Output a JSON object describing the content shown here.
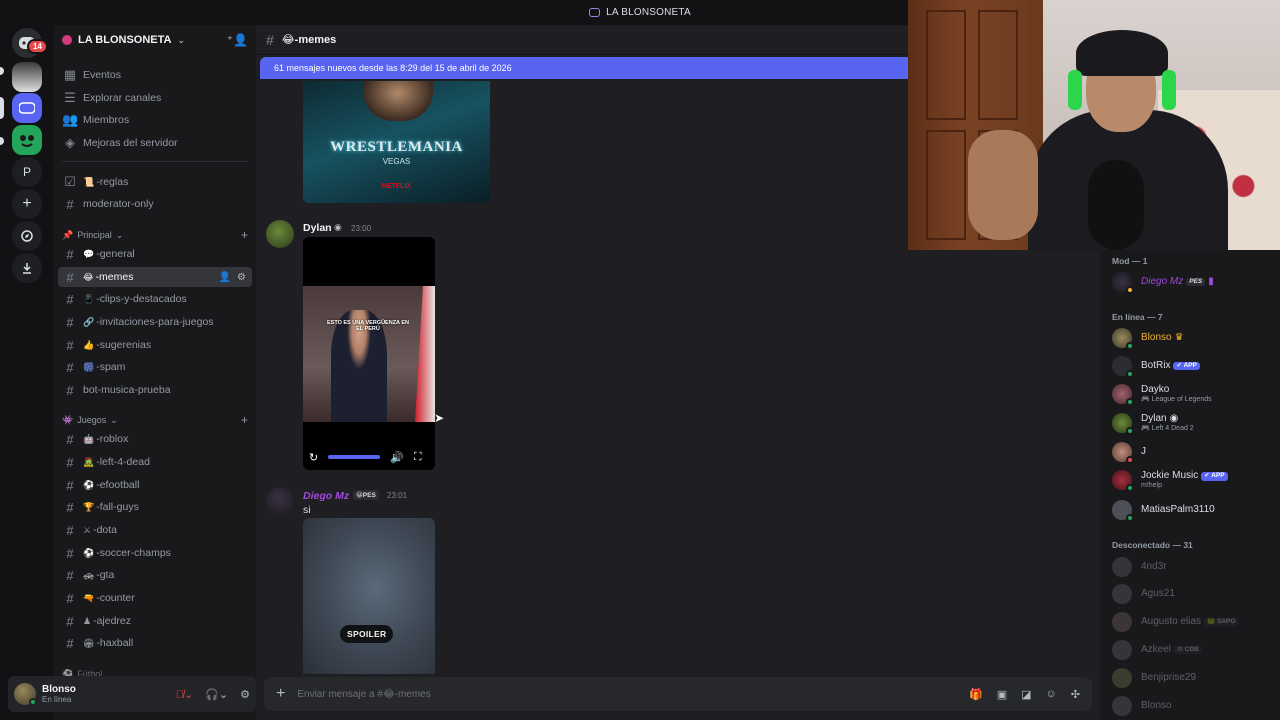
{
  "title_bar": {
    "title": "LA BLONSONETA"
  },
  "rail": {
    "notification_count": "14",
    "dm_letter": "P"
  },
  "server": {
    "name": "LA BLONSONETA"
  },
  "nav": [
    {
      "label": "Eventos",
      "icon": "calendar-icon"
    },
    {
      "label": "Explorar canales",
      "icon": "list-icon"
    },
    {
      "label": "Miembros",
      "icon": "members-icon"
    },
    {
      "label": "Mejoras del servidor",
      "icon": "boost-icon"
    }
  ],
  "top_channels": [
    {
      "label": "-reglas",
      "emoji": "📜"
    },
    {
      "label": "moderator-only",
      "emoji": ""
    }
  ],
  "categories": {
    "principal": "Principal",
    "juegos": "Juegos",
    "futbol": "Fútbol"
  },
  "principal_channels": [
    {
      "label": "-general",
      "emoji": "💬"
    },
    {
      "label": "-memes",
      "emoji": "😂",
      "active": true
    },
    {
      "label": "-clips-y-destacados",
      "emoji": "📱"
    },
    {
      "label": "-invitaciones-para-juegos",
      "emoji": "🔗"
    },
    {
      "label": "-sugerenias",
      "emoji": "👍"
    },
    {
      "label": "-spam",
      "emoji": "🎆"
    },
    {
      "label": "bot-musica-prueba",
      "emoji": ""
    }
  ],
  "juegos_channels": [
    {
      "label": "-roblox",
      "emoji": "🤖"
    },
    {
      "label": "-left-4-dead",
      "emoji": "🧟"
    },
    {
      "label": "-efootball",
      "emoji": "⚽"
    },
    {
      "label": "-fall-guys",
      "emoji": "🏆"
    },
    {
      "label": "-dota",
      "emoji": "⚔"
    },
    {
      "label": "-soccer-champs",
      "emoji": "⚽"
    },
    {
      "label": "-gta",
      "emoji": "🚓"
    },
    {
      "label": "-counter",
      "emoji": "🔫"
    },
    {
      "label": "-ajedrez",
      "emoji": "♟"
    },
    {
      "label": "-haxball",
      "emoji": "🏟"
    }
  ],
  "user": {
    "name": "Blonso",
    "status": "En línea"
  },
  "channel": {
    "name": "-memes",
    "emoji": "😂"
  },
  "new_messages_banner": "61 mensajes nuevos desde las 8:29 del 15 de abril de 2026",
  "image_embed": {
    "logo": "WRESTLEMANIA",
    "logo_sub": "VEGAS",
    "brand": "NETFLIX"
  },
  "messages": [
    {
      "author": "Dylan",
      "time": "23:00",
      "caption": "ESTO ES UNA VERGÜENZA EN EL PERÚ"
    },
    {
      "author": "Diego Mz",
      "badge": "PES",
      "time": "23:01",
      "text": "si",
      "spoiler_label": "SPOILER"
    }
  ],
  "composer": {
    "placeholder": "Enviar mensaje a #😂-memes"
  },
  "members": {
    "mod_header": "Mod — 1",
    "online_header": "En línea — 7",
    "offline_header": "Desconectado — 31",
    "mods": [
      {
        "name": "Diego Mz",
        "tag": "PES",
        "color": "#a04ad8"
      }
    ],
    "online": [
      {
        "name": "Blonso",
        "color": "#f0b232",
        "activity": ""
      },
      {
        "name": "BotRix",
        "tag": "APP",
        "color": "#dbdee1",
        "activity": ""
      },
      {
        "name": "Dayko",
        "color": "#dbdee1",
        "activity": "League of Legends"
      },
      {
        "name": "Dylan",
        "color": "#dbdee1",
        "activity": "Left 4 Dead 2"
      },
      {
        "name": "J",
        "color": "#dbdee1",
        "activity": ""
      },
      {
        "name": "Jockie Music",
        "tag": "APP",
        "color": "#dbdee1",
        "activity": "m!help"
      },
      {
        "name": "MatiasPalm3110",
        "color": "#dbdee1",
        "activity": ""
      }
    ],
    "offline": [
      {
        "name": "4nd3r",
        "tag": ""
      },
      {
        "name": "Agus21",
        "tag": ""
      },
      {
        "name": "Augusto elias",
        "tag": "SAPO"
      },
      {
        "name": "Azkeel",
        "tag": "CDB"
      },
      {
        "name": "Benjiprise29",
        "tag": ""
      },
      {
        "name": "Blonso",
        "tag": ""
      }
    ]
  }
}
